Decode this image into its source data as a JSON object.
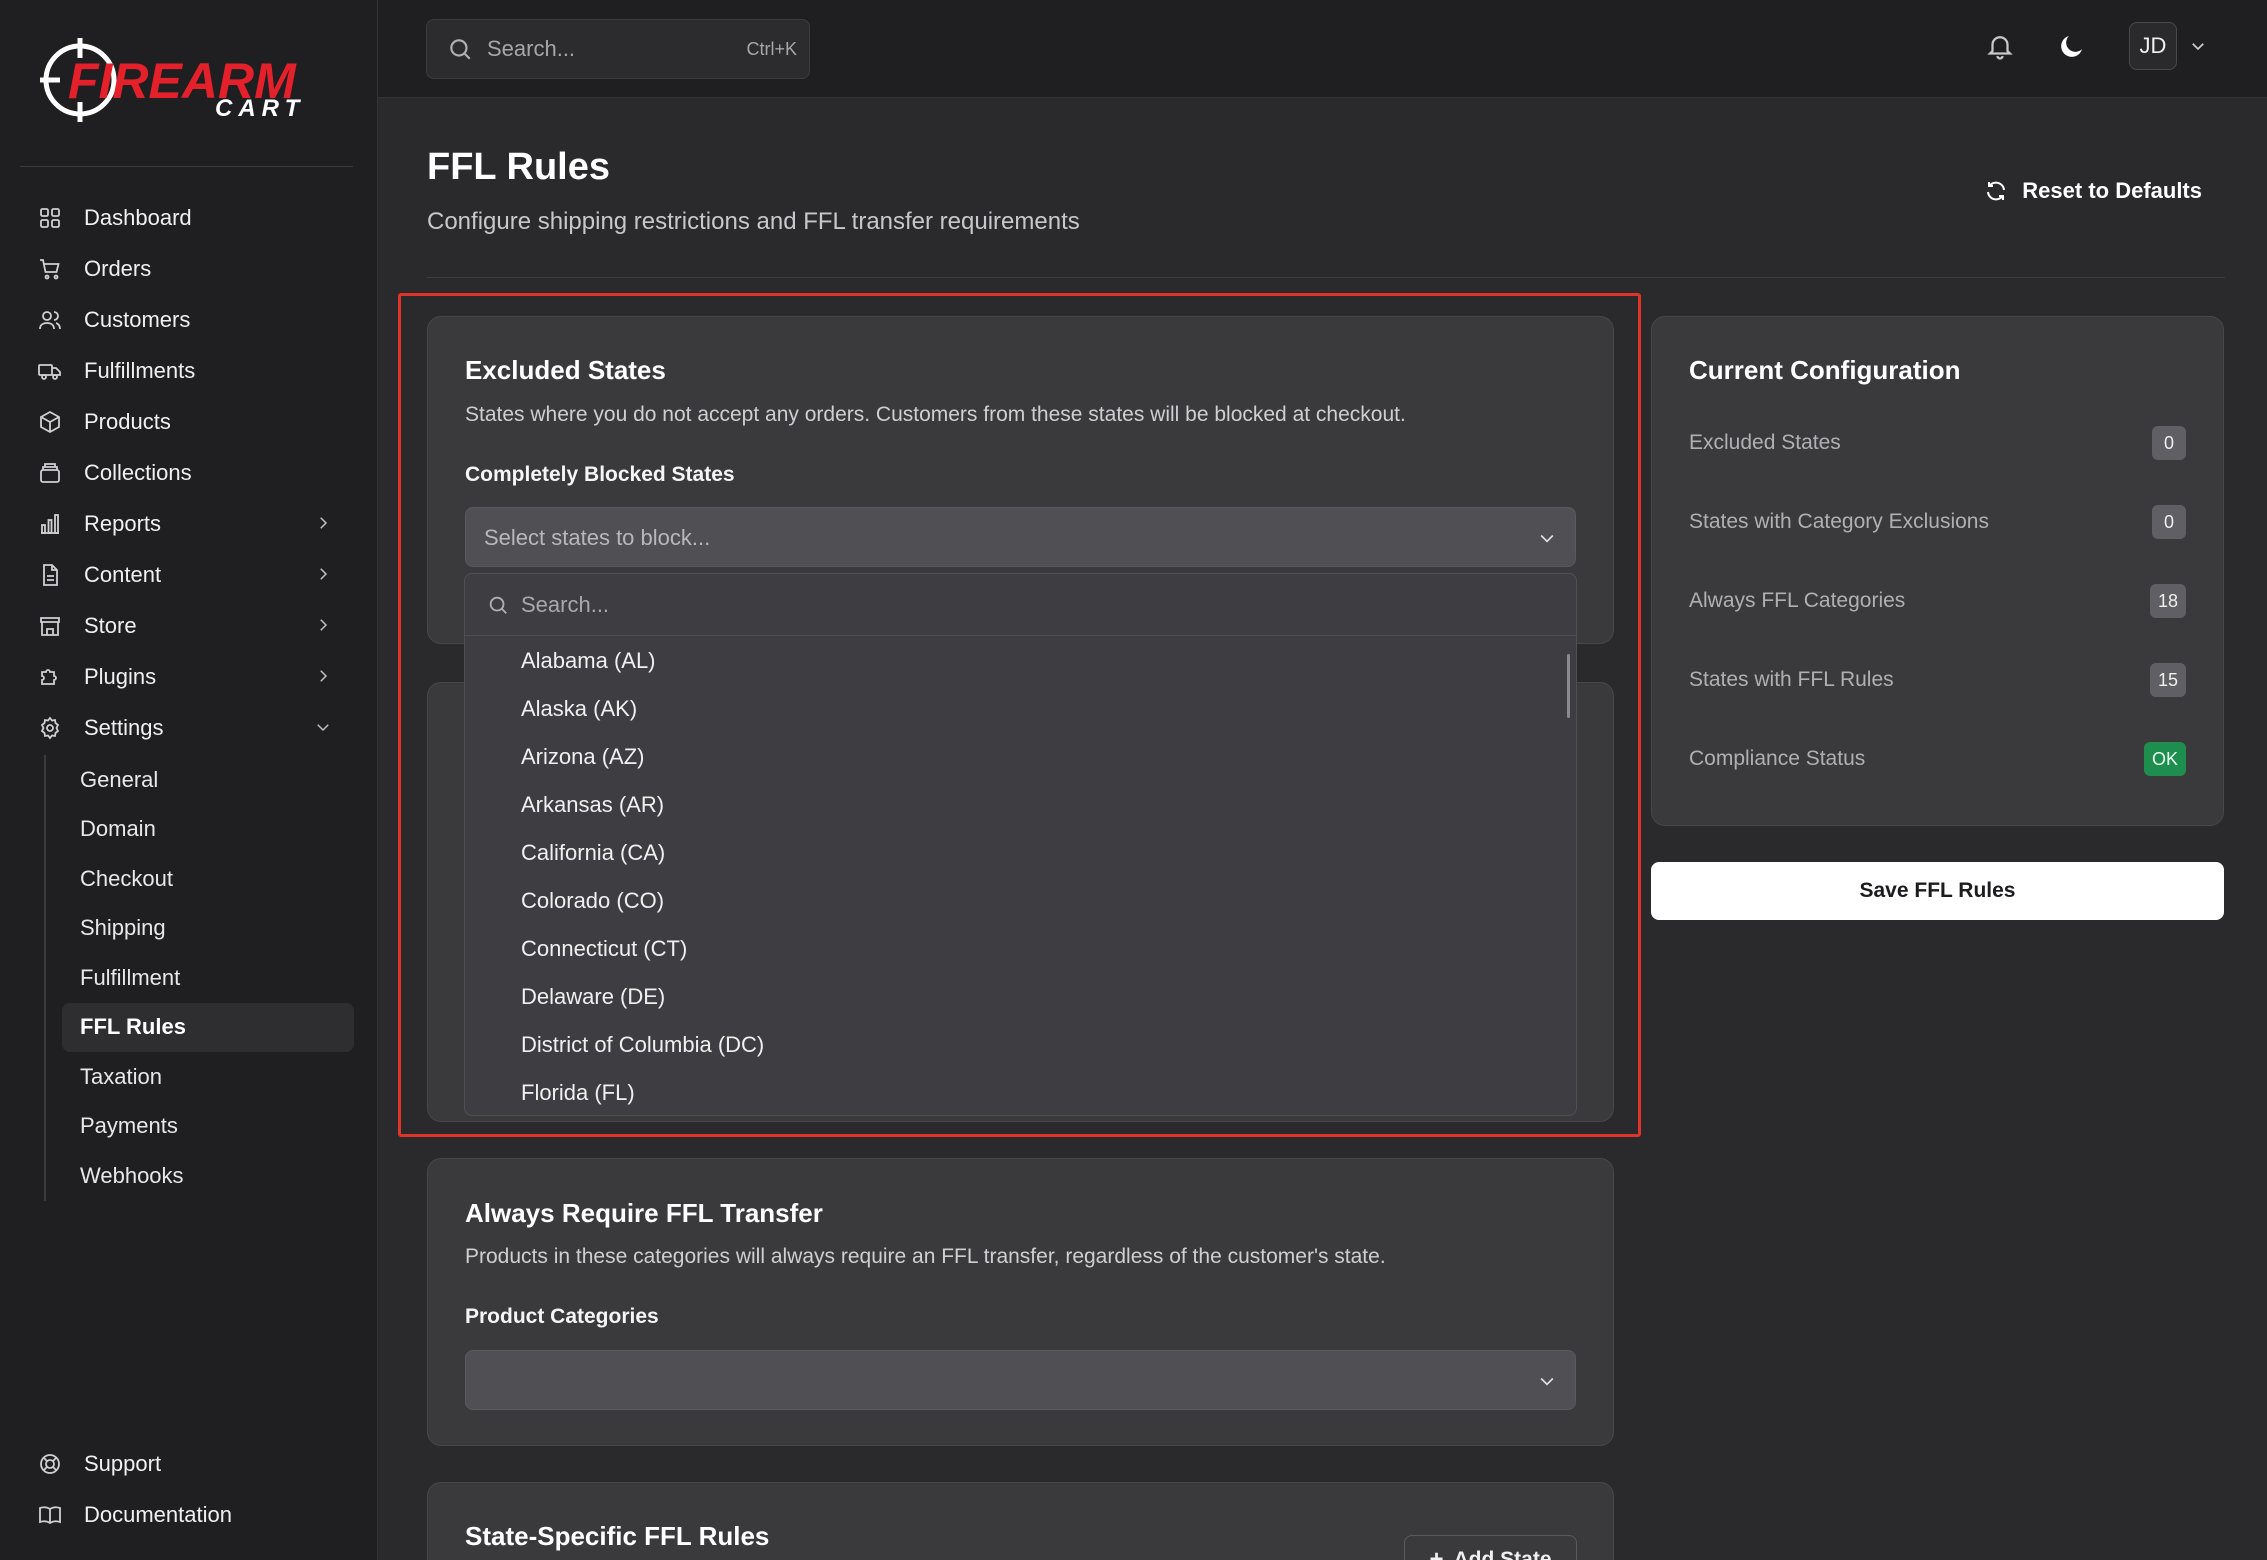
{
  "brand": {
    "name_top": "FIREARM",
    "name_bottom": "CART",
    "accent": "#e4202b"
  },
  "sidebar": {
    "items": [
      {
        "label": "Dashboard",
        "icon": "dashboard-icon"
      },
      {
        "label": "Orders",
        "icon": "cart-icon"
      },
      {
        "label": "Customers",
        "icon": "users-icon"
      },
      {
        "label": "Fulfillments",
        "icon": "truck-icon"
      },
      {
        "label": "Products",
        "icon": "box-icon"
      },
      {
        "label": "Collections",
        "icon": "layers-icon"
      },
      {
        "label": "Reports",
        "icon": "bar-chart-icon"
      },
      {
        "label": "Content",
        "icon": "document-icon"
      },
      {
        "label": "Store",
        "icon": "store-icon"
      },
      {
        "label": "Plugins",
        "icon": "puzzle-icon"
      },
      {
        "label": "Settings",
        "icon": "gear-icon"
      }
    ],
    "settings_sub": [
      "General",
      "Domain",
      "Checkout",
      "Shipping",
      "Fulfillment",
      "FFL Rules",
      "Taxation",
      "Payments",
      "Webhooks"
    ],
    "active_sub": "FFL Rules",
    "bottom": [
      {
        "label": "Support",
        "icon": "lifebuoy-icon"
      },
      {
        "label": "Documentation",
        "icon": "book-icon"
      }
    ]
  },
  "topbar": {
    "search_placeholder": "Search...",
    "search_shortcut": "Ctrl+K",
    "avatar_initials": "JD"
  },
  "page": {
    "title": "FFL Rules",
    "subtitle": "Configure shipping restrictions and FFL transfer requirements",
    "reset_label": "Reset to Defaults"
  },
  "excluded": {
    "title": "Excluded States",
    "desc": "States where you do not accept any orders. Customers from these states will be blocked at checkout.",
    "field_label": "Completely Blocked States",
    "placeholder": "Select states to block..."
  },
  "dropdown": {
    "search_placeholder": "Search...",
    "options": [
      "Alabama (AL)",
      "Alaska (AK)",
      "Arizona (AZ)",
      "Arkansas (AR)",
      "California (CA)",
      "Colorado (CO)",
      "Connecticut (CT)",
      "Delaware (DE)",
      "District of Columbia (DC)",
      "Florida (FL)"
    ]
  },
  "always_ffl": {
    "title": "Always Require FFL Transfer",
    "desc": "Products in these categories will always require an FFL transfer, regardless of the customer's state.",
    "field_label": "Product Categories"
  },
  "state_rules": {
    "title": "State-Specific FFL Rules",
    "add_label": "Add State"
  },
  "config": {
    "title": "Current Configuration",
    "rows": [
      {
        "label": "Excluded States",
        "value": "0"
      },
      {
        "label": "States with Category Exclusions",
        "value": "0"
      },
      {
        "label": "Always FFL Categories",
        "value": "18"
      },
      {
        "label": "States with FFL Rules",
        "value": "15"
      },
      {
        "label": "Compliance Status",
        "value": "OK",
        "status": "ok"
      }
    ],
    "status_color": "#1e8e4e"
  },
  "save_label": "Save FFL Rules"
}
